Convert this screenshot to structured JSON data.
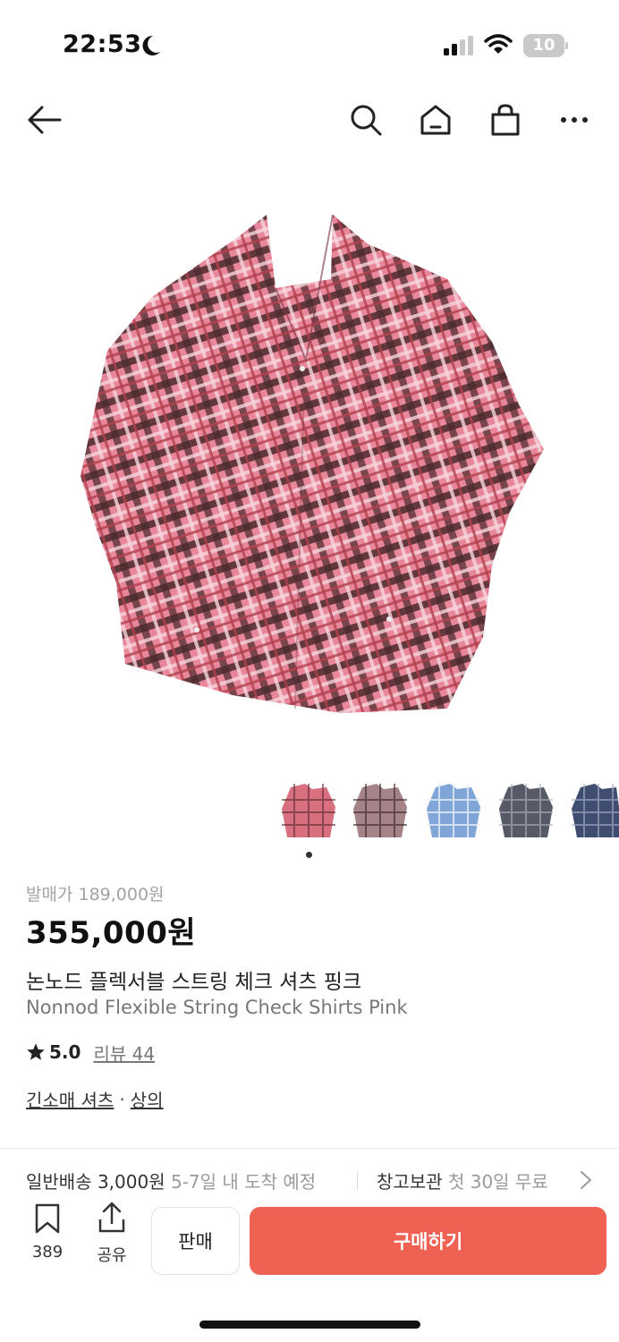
{
  "status_bar": {
    "time": "22:53",
    "battery": "10"
  },
  "nav": {
    "icons": [
      "back-arrow-icon",
      "search-icon",
      "home-icon",
      "shopping-bag-icon",
      "more-icon"
    ]
  },
  "product": {
    "image": "pink-plaid-check-shirt",
    "thumbnails": [
      "pink-check",
      "brown-check",
      "blue-check",
      "black-check",
      "navy-check"
    ],
    "release_price": "발매가 189,000원",
    "price": "355,000원",
    "name_ko": "논노드 플렉서블 스트링 체크 셔츠 핑크",
    "name_en": "Nonnod Flexible String Check Shirts Pink",
    "rating": "5.0",
    "review_label": "리뷰 44",
    "category_1": "긴소매 셔츠",
    "category_sep": "·",
    "category_2": "상의"
  },
  "shipping": {
    "normal_label": "일반배송 3,000원",
    "normal_eta": "5-7일 내 도착 예정",
    "storage_label": "창고보관",
    "storage_note": "첫 30일 무료"
  },
  "bottom_bar": {
    "bookmark_count": "389",
    "share_label": "공유",
    "sell_label": "판매",
    "buy_label": "구매하기"
  },
  "colors": {
    "accent": "#ef6253",
    "muted": "#a3a3a3"
  }
}
